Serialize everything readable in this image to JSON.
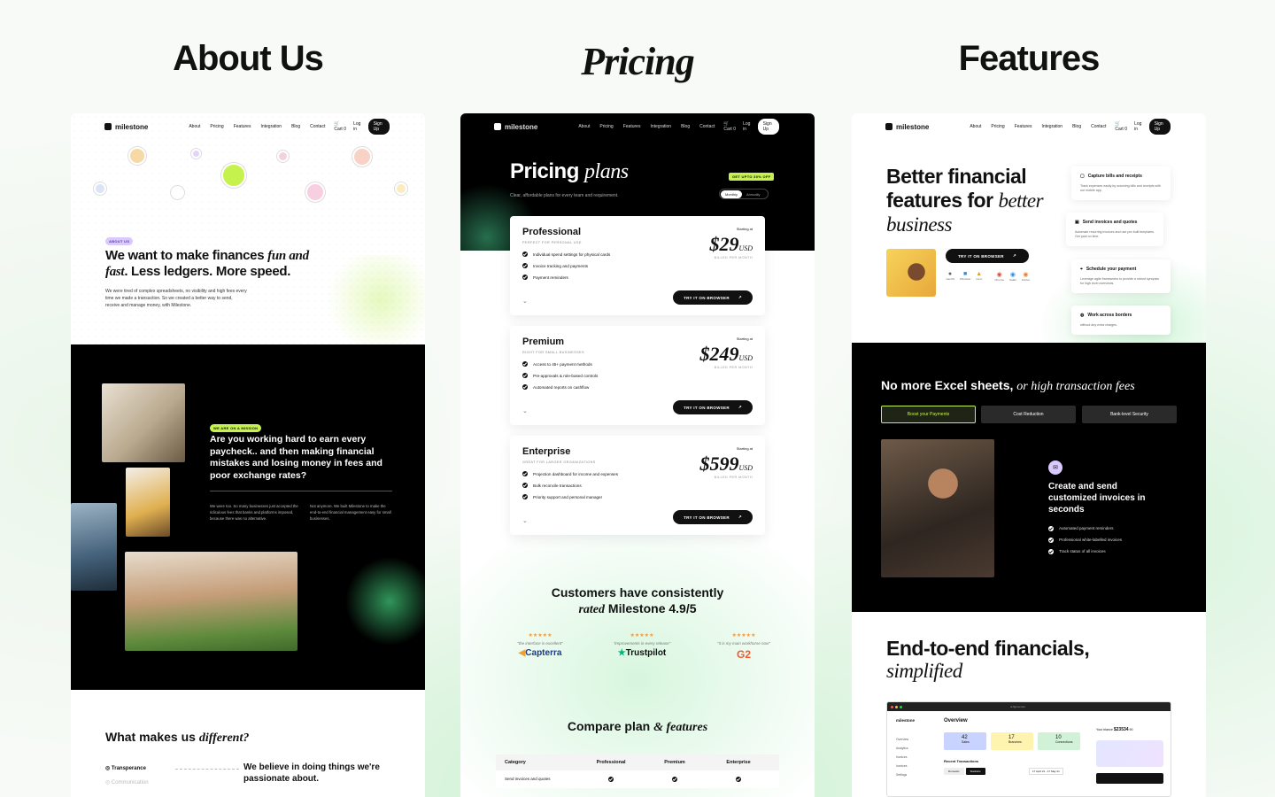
{
  "headings": {
    "about": "About Us",
    "pricing": "Pricing",
    "features": "Features"
  },
  "nav": {
    "logo": "milestone",
    "links": [
      "About",
      "Pricing",
      "Features",
      "Integration",
      "Blog",
      "Contact"
    ],
    "cart": "Cart",
    "cart_count": "0",
    "login": "Log in",
    "signup": "Sign Up"
  },
  "about": {
    "badge": "ABOUT US",
    "headline_a": "We want to make finances ",
    "headline_em1": "fun and fast",
    "headline_b": ". Less ledgers. More speed.",
    "body": "We were tired of complex spreadsheets, no visibility and high fees every time we made a transaction. So we created a better way to send, receive and manage money, with Milestone.",
    "mission_badge": "WE ARE ON A MISSION",
    "mission_headline": "Are you working hard to earn every paycheck.. and then making financial mistakes and losing money in fees and poor exchange rates?",
    "col1": "We were too. So many businesses just accepted the ridiculous fees that banks and platforms imposed, because there was no alternative.",
    "col2": "Not anymore. We built Milestone to make the end-to-end financial management easy for small businesses.",
    "diff_a": "What makes us ",
    "diff_em": "different?",
    "diff_items": [
      "Transperance",
      "Communication"
    ],
    "diff_text": "We believe in doing things we're passionate about."
  },
  "pricing": {
    "hero_a": "Pricing ",
    "hero_em": "plans",
    "hero_sub": "Clear, affordable plans for every team and requirement.",
    "promo": "GET UPTO 30% OFF",
    "toggle": [
      "Monthly",
      "Annually"
    ],
    "cards": [
      {
        "name": "Professional",
        "sub": "PERFECT FOR PERSONAL USE",
        "starting": "Starting at",
        "amount": "$29",
        "unit": "USD",
        "billed": "BILLED PER MONTH",
        "features": [
          "Individual spend settings for physical cards",
          "Invoice tracking and payments",
          "Payment reminders"
        ],
        "cta": "TRY IT ON BROWSER"
      },
      {
        "name": "Premium",
        "sub": "RIGHT FOR SMALL BUSINESSES",
        "starting": "Starting at",
        "amount": "$249",
        "unit": "USD",
        "billed": "BILLED PER MONTH",
        "features": [
          "Access to 45+ payment methods",
          "Pre-approvals & role-based controls",
          "Automated reports on cashflow"
        ],
        "cta": "TRY IT ON BROWSER"
      },
      {
        "name": "Enterprise",
        "sub": "GREAT FOR LARGER ORGANIZATIONS",
        "starting": "Starting at",
        "amount": "$599",
        "unit": "USD",
        "billed": "BILLED PER MONTH",
        "features": [
          "Projection dashboard for income and expenses",
          "Bulk reconcile transactions",
          "Priority support and personal manager"
        ],
        "cta": "TRY IT ON BROWSER"
      }
    ],
    "rated_a": "Customers have consistently",
    "rated_em": "rated",
    "rated_b": " Milestone 4.9/5",
    "reviews": [
      {
        "quote": "\"the interface is excellent\"",
        "brand": "Capterra",
        "color": "#1a3a8a"
      },
      {
        "quote": "\"improvements in every release\"",
        "brand": "Trustpilot",
        "color": "#111111"
      },
      {
        "quote": "\"it is my main workhorse now\"",
        "brand": "G2",
        "color": "#f25a2e"
      }
    ],
    "stars": "★★★★★",
    "compare_a": "Compare plan ",
    "compare_em": "& features",
    "table_headers": [
      "Category",
      "Professional",
      "Premium",
      "Enterprise"
    ],
    "table_row": "Send invoices and quotes"
  },
  "features": {
    "hero_a": "Better financial features for ",
    "hero_em": "better business",
    "cta": "TRY IT ON BROWSER",
    "platforms": [
      "macOS",
      "Windows",
      "Linux",
      "Chrome",
      "Safari",
      "Firefox"
    ],
    "cards": [
      {
        "title": "Capture bills and receipts",
        "desc": "Track expenses easily by scanning bills and receipts with our mobile app."
      },
      {
        "title": "Send invoices and quotes",
        "desc": "Automate recurring invoices and use pre-built templates. Get paid on time."
      },
      {
        "title": "Schedule your payment",
        "desc": "Leverage agile frameworks to provide a robust synopsis for high level overviews."
      },
      {
        "title": "Work across borders",
        "desc": "without any extra charges."
      }
    ],
    "excel_a": "No more Excel sheets, ",
    "excel_em": "or high transaction fees",
    "tabs": [
      "Boost your Payments",
      "Cost Reduction",
      "Bank-level Security"
    ],
    "invoice_title": "Create and send customized invoices in seconds",
    "invoice_points": [
      "Automated payment reminders",
      "Professional white-labelled invoices",
      "Track status of all invoices"
    ],
    "end_a": "End-to-end financials,",
    "end_em": "simplified",
    "dash": {
      "url": "ui.figma.com",
      "logo": "milestone",
      "overview": "Overview",
      "menu": [
        "Overview",
        "Analytics",
        "Invoices",
        "Invoices",
        "Settings"
      ],
      "stats": [
        {
          "n": "42",
          "l": "Sales"
        },
        {
          "n": "17",
          "l": "Branches"
        },
        {
          "n": "10",
          "l": "Connections"
        }
      ],
      "recent": "Recent Transactions",
      "filters": [
        "Domestic",
        "Statistics"
      ],
      "date": "17 April 21 - 17 May 21",
      "balance_label": "Your blance",
      "balance": "$23534",
      "balance_cents": ".90"
    }
  },
  "colors": {
    "accent": "#c6f24e",
    "purple": "#d9c9ff",
    "dark": "#000000"
  }
}
